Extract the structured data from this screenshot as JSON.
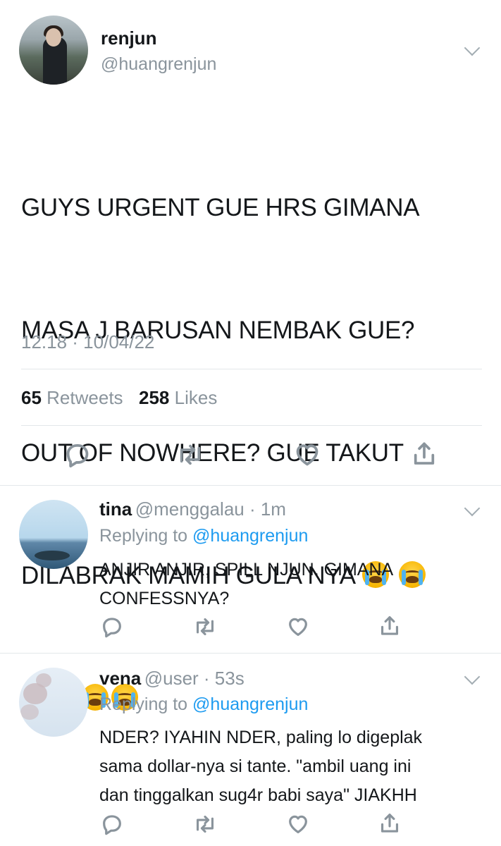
{
  "main_tweet": {
    "display_name": "renjun",
    "handle": "@huangrenjun",
    "text_lines": [
      "GUYS URGENT GUE HRS GIMANA",
      "MASA J BARUSAN NEMBAK GUE?",
      "OUT OF NOWHERE? GUE TAKUT",
      "DILABRAK MAMIH GULA NYA"
    ],
    "emoji": "loudly-crying-face",
    "timestamp": "12.18 · 10/04/22",
    "retweet_count": "65",
    "retweet_label": "Retweets",
    "like_count": "258",
    "like_label": "Likes"
  },
  "replies": [
    {
      "display_name": "tina",
      "handle_time": "@menggalau · 1m",
      "replying_prefix": "Replying to",
      "replying_handle": "@huangrenjun",
      "text": "ANJIR ANJIR, SPILL NJUN. GIMANA\nCONFESSNYA?"
    },
    {
      "display_name": "vena",
      "handle_time": "@user · 53s",
      "replying_prefix": "Replying to",
      "replying_handle": "@huangrenjun",
      "text": "NDER? IYAHIN NDER, paling lo digeplak\nsama dollar-nya si tante. \"ambil uang ini\ndan tinggalkan sug4r babi saya\" JIAKHH"
    }
  ],
  "icons": [
    "reply-icon",
    "retweet-icon",
    "like-icon",
    "share-icon",
    "chevron-down-icon"
  ],
  "colors": {
    "text": "#14171a",
    "muted": "#8a949c",
    "link": "#1d9bf0",
    "divider": "#e3e7ea"
  }
}
